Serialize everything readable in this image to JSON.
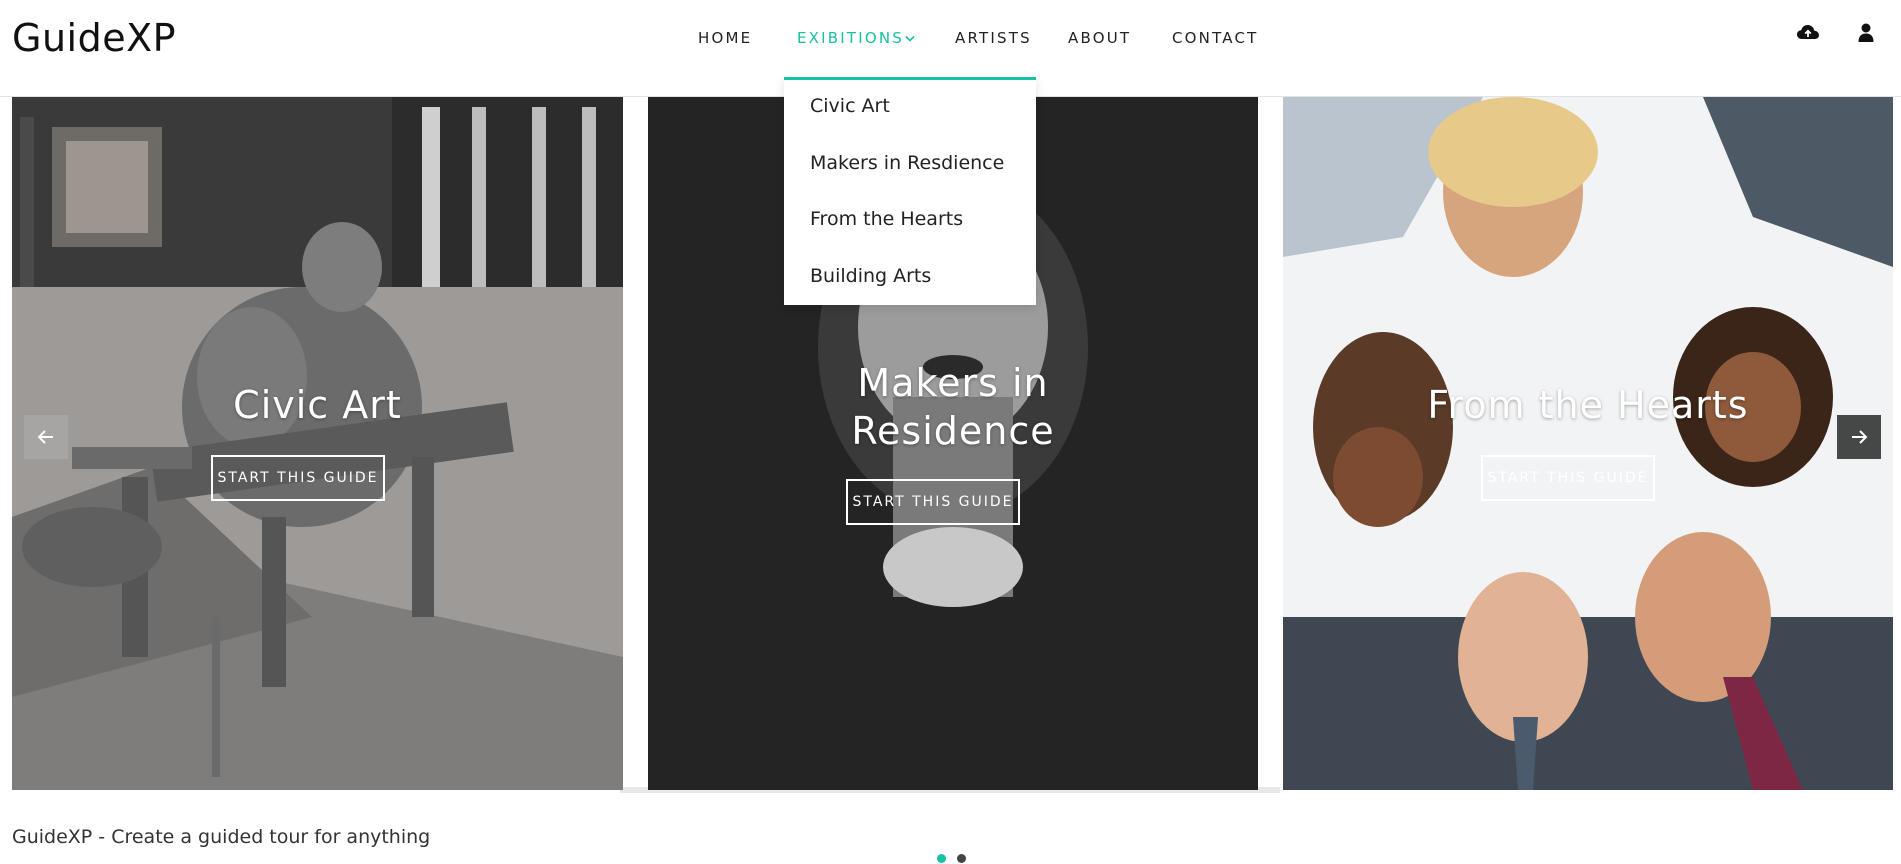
{
  "brand": {
    "name": "GuideXP"
  },
  "nav": {
    "items": [
      {
        "label": "HOME"
      },
      {
        "label": "EXIBITIONS",
        "active": true
      },
      {
        "label": "ARTISTS"
      },
      {
        "label": "ABOUT"
      },
      {
        "label": "CONTACT"
      }
    ],
    "icons": [
      "cloud-upload-icon",
      "user-icon"
    ]
  },
  "dropdown": {
    "items": [
      {
        "label": "Civic Art"
      },
      {
        "label": "Makers in Resdience"
      },
      {
        "label": "From the Hearts"
      },
      {
        "label": "Building Arts"
      }
    ]
  },
  "slides": [
    {
      "title": "Civic Art",
      "button": "START THIS GUIDE"
    },
    {
      "title_line1": "Makers in",
      "title_line2": "Residence",
      "button": "START THIS GUIDE"
    },
    {
      "title": "From the Hearts",
      "button": "START THIS GUIDE"
    }
  ],
  "carousel": {
    "dot_count": 2,
    "active_dot": 0,
    "accent": "#17c1a1"
  },
  "footer": {
    "tagline": "GuideXP - Create a guided tour for anything"
  },
  "colors": {
    "accent": "#17c1a1",
    "dark": "#222222"
  }
}
